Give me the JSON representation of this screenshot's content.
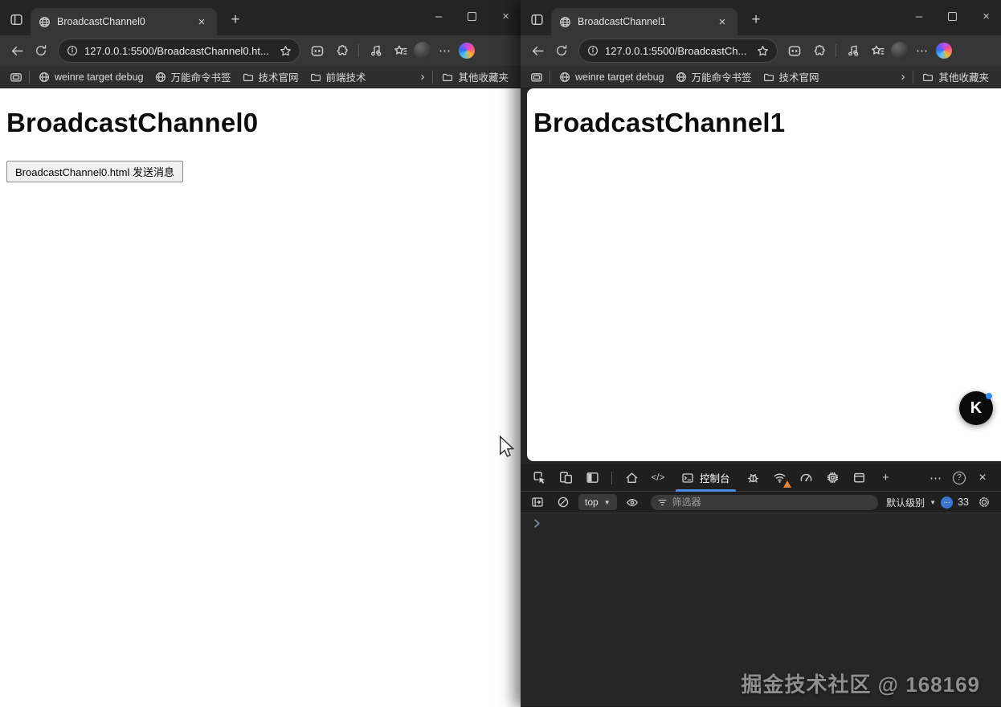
{
  "icons": {
    "close": "×",
    "plus": "+",
    "minimize": "–",
    "more": "⋯",
    "help": "?",
    "chevron": "›",
    "dropdown": "▼",
    "code": "</>",
    "bubble_dots": "⋯",
    "logo_letter": "K"
  },
  "left_window": {
    "tab_title": "BroadcastChannel0",
    "url": "127.0.0.1:5500/BroadcastChannel0.ht...",
    "bookmarks": [
      {
        "label": "weinre target debug"
      },
      {
        "label": "万能命令书签"
      },
      {
        "label": "技术官网"
      },
      {
        "label": "前端技术"
      }
    ],
    "other_favorites": "其他收藏夹",
    "page": {
      "heading": "BroadcastChannel0",
      "send_button": "BroadcastChannel0.html 发送消息"
    }
  },
  "right_window": {
    "tab_title": "BroadcastChannel1",
    "url": "127.0.0.1:5500/BroadcastCh...",
    "bookmarks": [
      {
        "label": "weinre target debug"
      },
      {
        "label": "万能命令书签"
      },
      {
        "label": "技术官网"
      }
    ],
    "other_favorites": "其他收藏夹",
    "page": {
      "heading": "BroadcastChannel1"
    }
  },
  "devtools": {
    "console_tab": "控制台",
    "context_selector": "top",
    "filter_placeholder": "筛选器",
    "log_level": "默认级别",
    "issues_count": "33"
  },
  "watermark": "掘金技术社区 @ 168169",
  "colors": {
    "accent_blue": "#4e8ce0",
    "warning_orange": "#e8833a",
    "issues_badge": "#3b78d2",
    "chrome_toolbar": "#363636",
    "tab_strip": "#242424",
    "bookmarks_bar": "#2e2e2e",
    "devtools_bg": "#1f1f1f",
    "console_bg": "#262626",
    "page_bg": "#ffffff"
  }
}
